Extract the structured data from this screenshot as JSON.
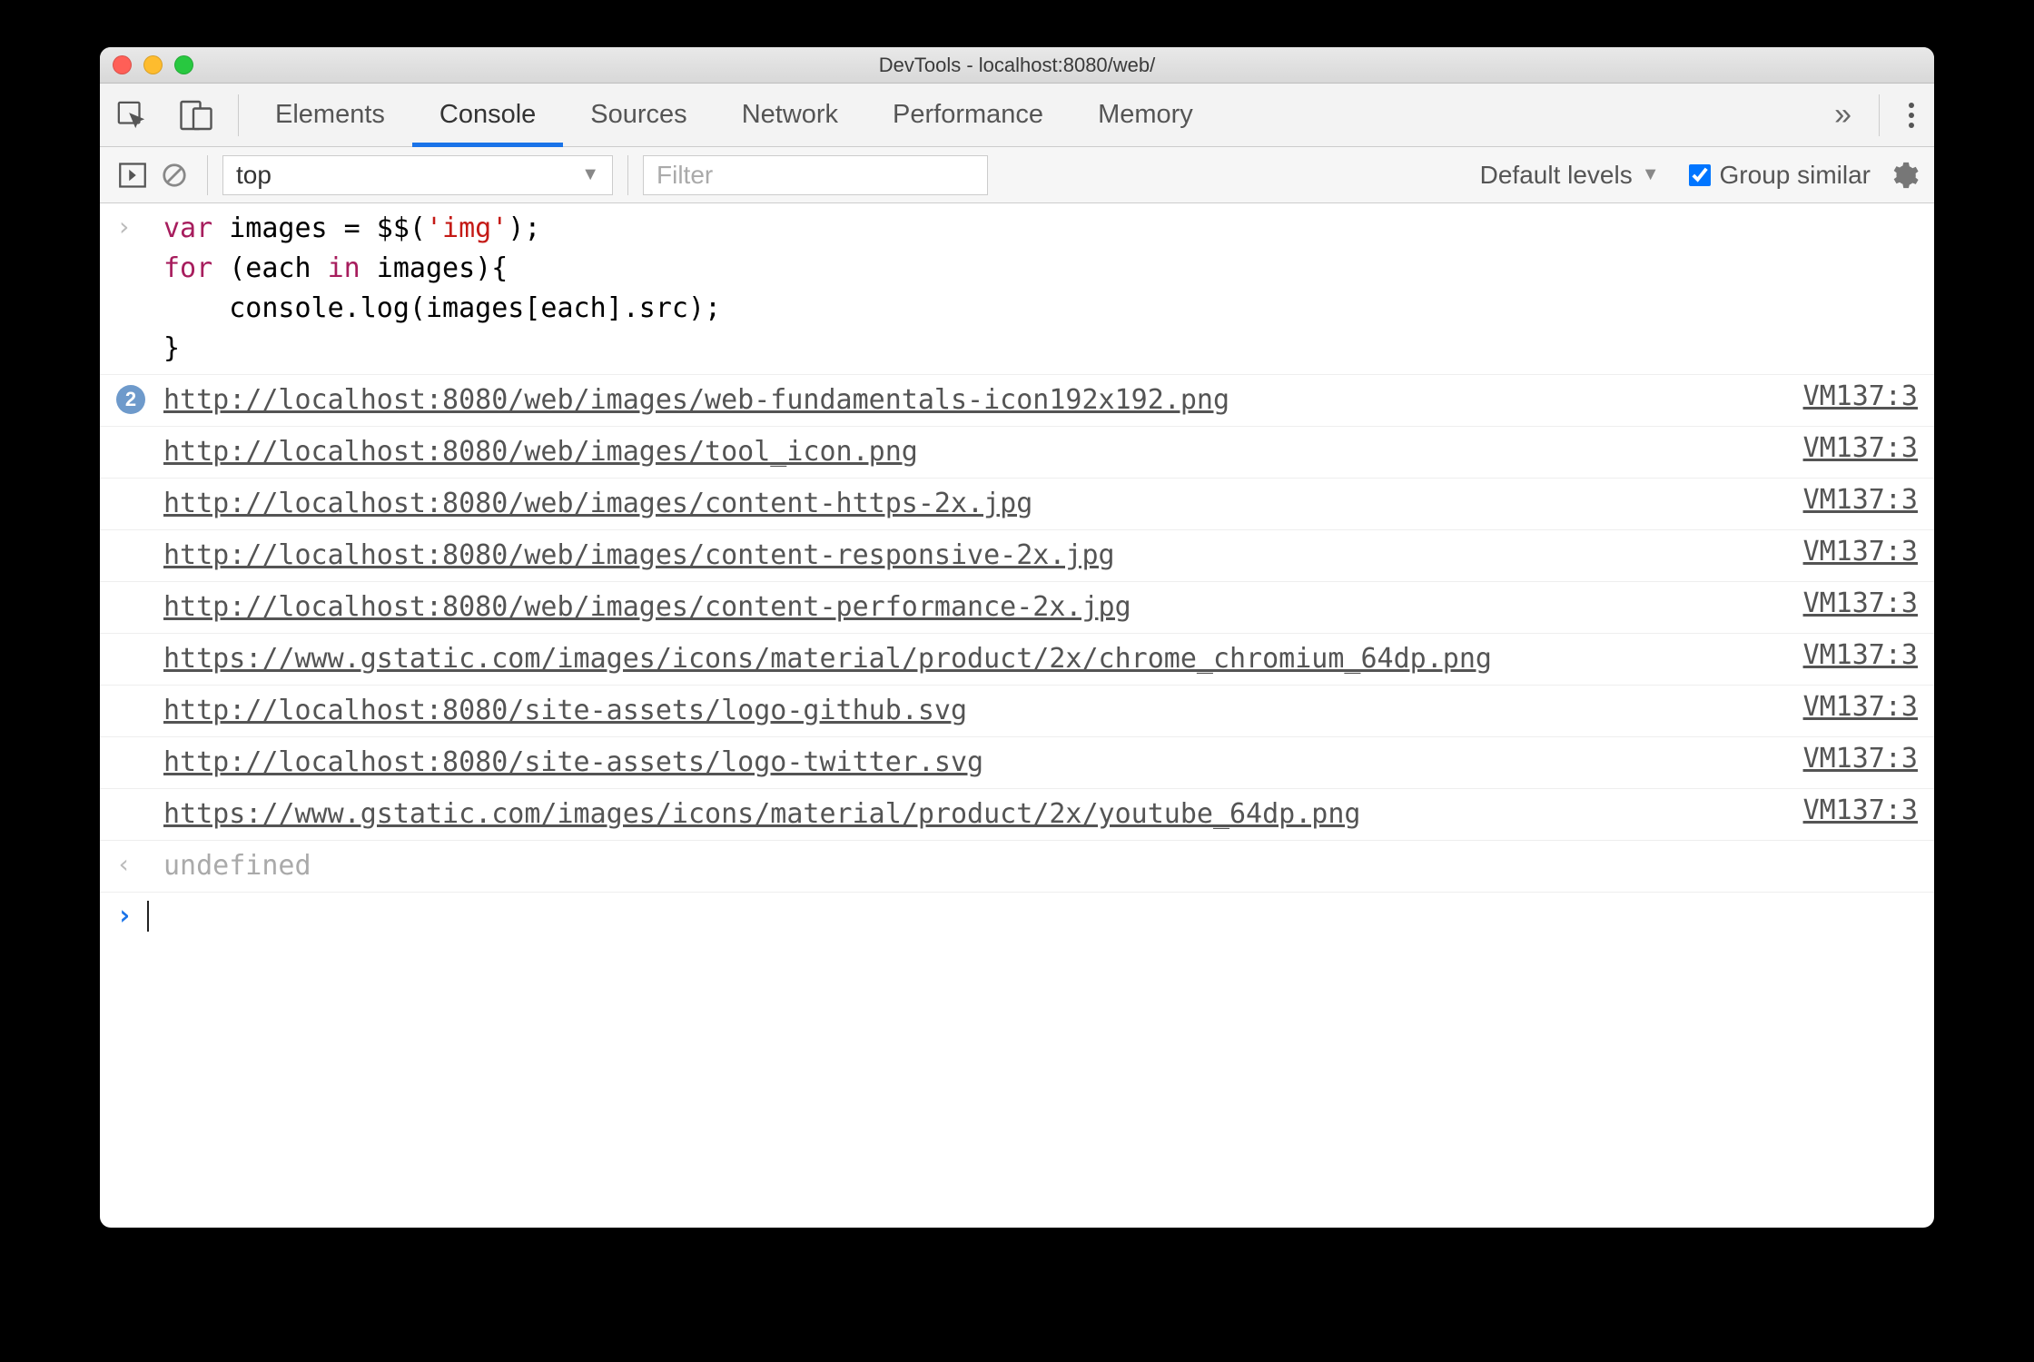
{
  "window": {
    "title": "DevTools - localhost:8080/web/"
  },
  "tabs": {
    "items": [
      "Elements",
      "Console",
      "Sources",
      "Network",
      "Performance",
      "Memory"
    ],
    "active_index": 1,
    "overflow_glyph": "»"
  },
  "filter": {
    "context": "top",
    "placeholder": "Filter",
    "levels_label": "Default levels",
    "group_checked": true,
    "group_label": "Group similar"
  },
  "input_code": {
    "line1_a": "var",
    "line1_b": " images = $$(",
    "line1_c": "'img'",
    "line1_d": ");",
    "line2_a": "for",
    "line2_b": " (each ",
    "line2_c": "in",
    "line2_d": " images){",
    "line3": "    console.log(images[each].src);",
    "line4": "}"
  },
  "log": {
    "badge_count": "2",
    "entries": [
      {
        "text": "http://localhost:8080/web/images/web-fundamentals-icon192x192.png",
        "src": "VM137:3",
        "badge": true
      },
      {
        "text": "http://localhost:8080/web/images/tool_icon.png",
        "src": "VM137:3"
      },
      {
        "text": "http://localhost:8080/web/images/content-https-2x.jpg",
        "src": "VM137:3"
      },
      {
        "text": "http://localhost:8080/web/images/content-responsive-2x.jpg",
        "src": "VM137:3"
      },
      {
        "text": "http://localhost:8080/web/images/content-performance-2x.jpg",
        "src": "VM137:3"
      },
      {
        "text": "https://www.gstatic.com/images/icons/material/product/2x/chrome_chromium_64dp.png",
        "src": "VM137:3"
      },
      {
        "text": "http://localhost:8080/site-assets/logo-github.svg",
        "src": "VM137:3"
      },
      {
        "text": "http://localhost:8080/site-assets/logo-twitter.svg",
        "src": "VM137:3"
      },
      {
        "text": "https://www.gstatic.com/images/icons/material/product/2x/youtube_64dp.png",
        "src": "VM137:3"
      }
    ]
  },
  "return_value": "undefined"
}
